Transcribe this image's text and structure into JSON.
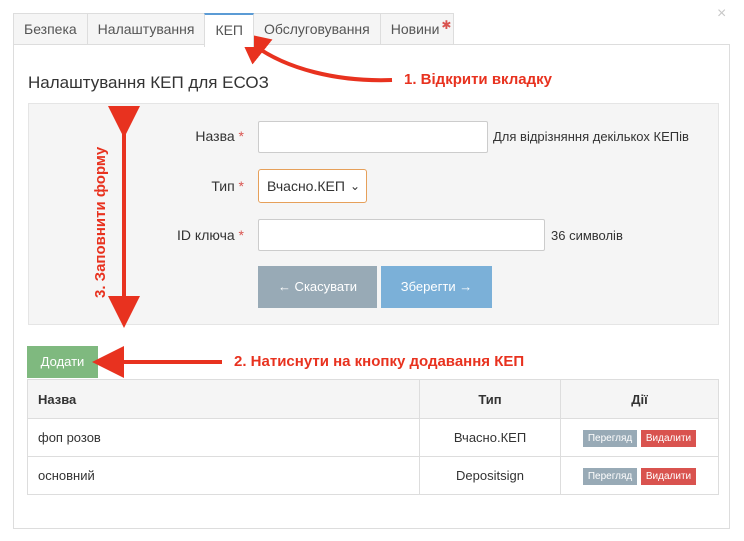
{
  "window": {
    "close_glyph": "×"
  },
  "tabs": [
    {
      "label": "Безпека",
      "active": false
    },
    {
      "label": "Налаштування",
      "active": false
    },
    {
      "label": "КЕП",
      "active": true
    },
    {
      "label": "Обслуговування",
      "active": false
    },
    {
      "label": "Новини",
      "active": false,
      "badge": "✱"
    }
  ],
  "page": {
    "title": "Налаштування КЕП для ЕСОЗ"
  },
  "form": {
    "name": {
      "label": "Назва",
      "required_mark": "*",
      "value": "",
      "hint": "Для відрізняння декількох КЕПів"
    },
    "type": {
      "label": "Тип",
      "required_mark": "*",
      "selected": "Вчасно.КЕП"
    },
    "key_id": {
      "label": "ID ключа",
      "required_mark": "*",
      "value": "",
      "hint": "36 символів"
    },
    "cancel_label": "← Скасувати",
    "save_label": "Зберегти →"
  },
  "add_button_label": "Додати",
  "table": {
    "headers": {
      "name": "Назва",
      "type": "Тип",
      "actions": "Дії"
    },
    "rows": [
      {
        "name": "фоп розов",
        "type": "Вчасно.КЕП",
        "view_label": "Перегляд",
        "delete_label": "Видалити"
      },
      {
        "name": "основний",
        "type": "Depositsign",
        "view_label": "Перегляд",
        "delete_label": "Видалити"
      }
    ]
  },
  "annotations": {
    "step1": "1. Відкрити вкладку",
    "step2": "2. Натиснути на кнопку додавання КЕП",
    "step3": "3. Заповнити форму",
    "color": "#e8321f"
  }
}
